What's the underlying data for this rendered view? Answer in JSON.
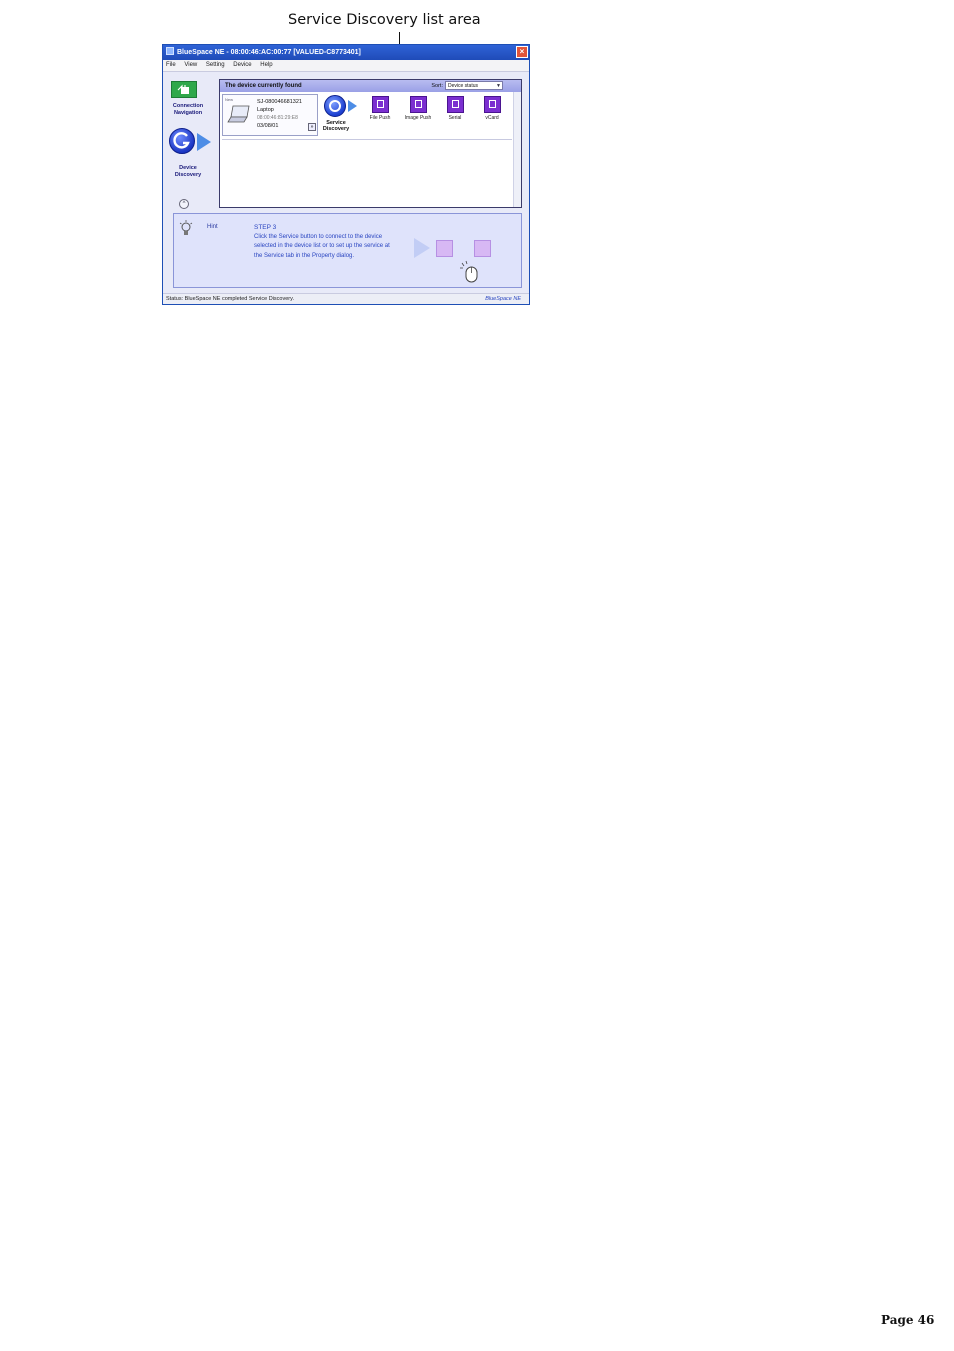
{
  "callout": {
    "label": "Service Discovery list area"
  },
  "window": {
    "title": "BlueSpace NE - 08:00:46:AC:00:77 [VALUED-C8773401]",
    "close_glyph": "×"
  },
  "menu": {
    "items": [
      "File",
      "View",
      "Setting",
      "Device",
      "Help"
    ]
  },
  "nav": {
    "connection_label_1": "Connection",
    "connection_label_2": "Navigation",
    "discovery_label_1": "Device",
    "discovery_label_2": "Discovery",
    "up_glyph": "^"
  },
  "panel": {
    "header": "The device currently found",
    "sort_label": "Sort:",
    "sort_value": "Device status",
    "sort_chevron": "▼"
  },
  "device": {
    "tag": "New",
    "name": "SJ-080046681321",
    "type": "Laptop",
    "address": "08:00:46:81:29:E8",
    "date": "03/08/01",
    "button_glyph": "»"
  },
  "service_discovery": {
    "label_1": "Service",
    "label_2": "Discovery"
  },
  "services": [
    {
      "label": "File Push"
    },
    {
      "label": "Image Push"
    },
    {
      "label": "Serial"
    },
    {
      "label": "vCard"
    }
  ],
  "hint": {
    "label": "Hint",
    "step": "STEP 3",
    "text": "Click the Service button to connect to the device selected in the device list or to set up the service at the Service tab in the Property dialog."
  },
  "status": {
    "text": "Status: BlueSpace NE completed Service Discovery.",
    "brand": "BlueSpace NE"
  },
  "page": {
    "number": "Page 46"
  },
  "colors": {
    "titlebar": "#1f4bb8",
    "service_icon": "#7b2fd0",
    "hint_text": "#2a45c0",
    "nav_green": "#2fa84b"
  }
}
